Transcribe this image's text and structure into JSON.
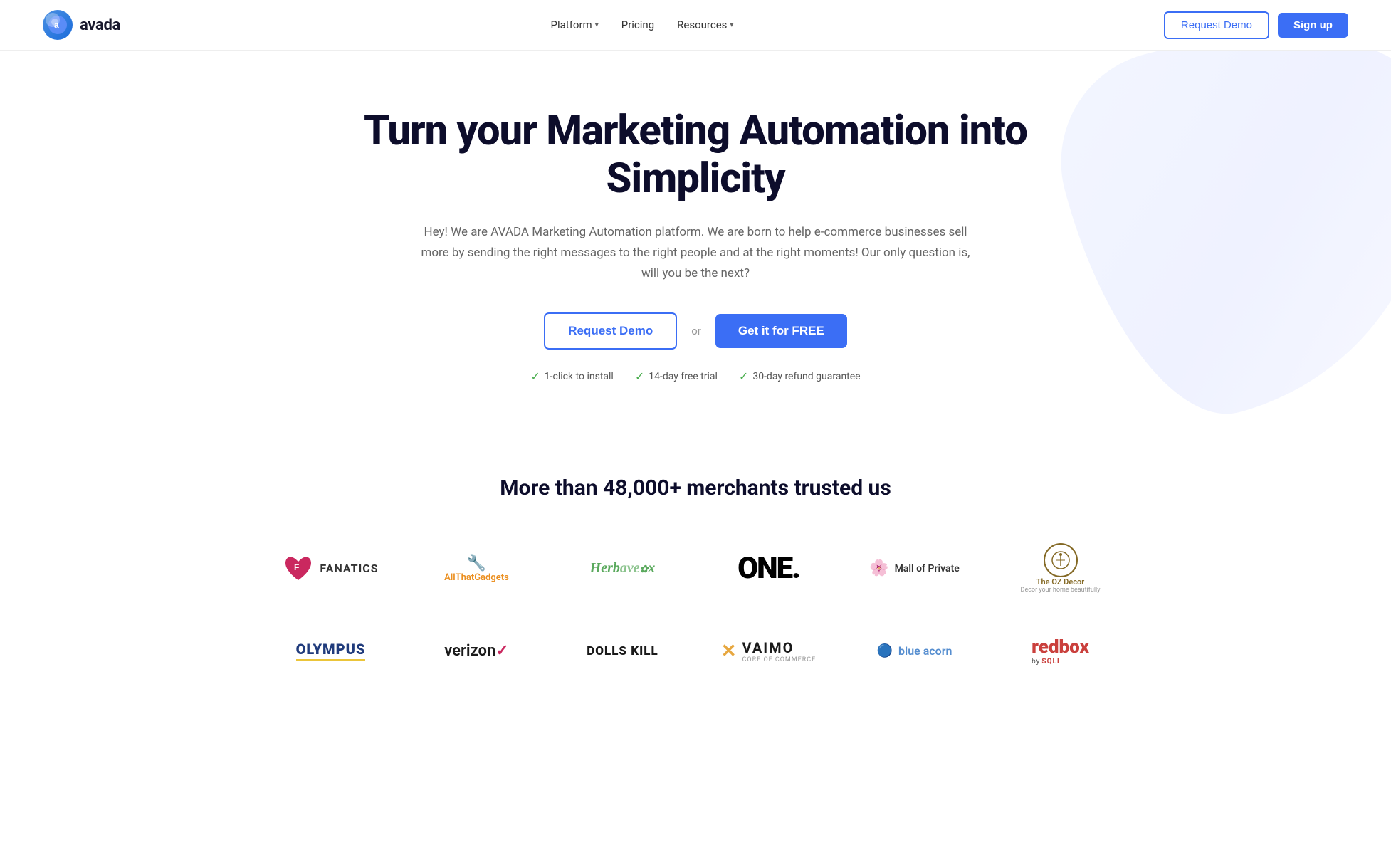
{
  "navbar": {
    "logo_text": "avada",
    "logo_letter": "a",
    "nav_items": [
      {
        "label": "Platform",
        "has_dropdown": true
      },
      {
        "label": "Pricing",
        "has_dropdown": false
      },
      {
        "label": "Resources",
        "has_dropdown": true
      }
    ],
    "request_demo_label": "Request Demo",
    "signup_label": "Sign up"
  },
  "hero": {
    "title": "Turn your Marketing Automation into Simplicity",
    "subtitle": "Hey! We are AVADA Marketing Automation platform. We are born to help e-commerce businesses sell more by sending the right messages to the right people and at the right moments! Our only question is, will you be the next?",
    "cta_request_demo": "Request Demo",
    "cta_or": "or",
    "cta_get_free": "Get it for FREE",
    "badge_1": "1-click to install",
    "badge_2": "14-day free trial",
    "badge_3": "30-day refund guarantee"
  },
  "trusted": {
    "title": "More than 48,000+ merchants trusted us",
    "logos": [
      {
        "name": "Fanatics",
        "type": "fanatics"
      },
      {
        "name": "AllThatGadgets",
        "type": "allthatgadgets"
      },
      {
        "name": "Herbavex",
        "type": "herbavex"
      },
      {
        "name": "ONE.",
        "type": "one"
      },
      {
        "name": "Mall of Private",
        "type": "mallofprivate"
      },
      {
        "name": "The OZ Decor",
        "type": "ozdecor"
      },
      {
        "name": "OLYMPUS",
        "type": "olympus"
      },
      {
        "name": "verizon",
        "type": "verizon"
      },
      {
        "name": "DOLLS KILL",
        "type": "dollskill"
      },
      {
        "name": "VAIMO",
        "type": "vaimo"
      },
      {
        "name": "blue acorn",
        "type": "blueacorn"
      },
      {
        "name": "redbox",
        "type": "redbox"
      }
    ]
  }
}
